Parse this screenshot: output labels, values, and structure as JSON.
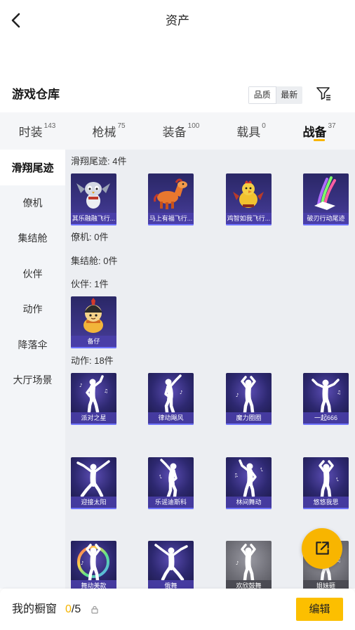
{
  "header": {
    "title": "资产",
    "back_icon": "back-arrow-icon"
  },
  "warehouse": {
    "title": "游戏仓库",
    "sort_options": [
      {
        "label": "品质",
        "selected": true
      },
      {
        "label": "最新",
        "selected": false
      }
    ],
    "filter_icon": "filter-icon"
  },
  "tabs": [
    {
      "label": "时装",
      "count": "143",
      "selected": false
    },
    {
      "label": "枪械",
      "count": "75",
      "selected": false
    },
    {
      "label": "装备",
      "count": "100",
      "selected": false
    },
    {
      "label": "载具",
      "count": "0",
      "selected": false
    },
    {
      "label": "战备",
      "count": "37",
      "selected": true
    }
  ],
  "sidebar": {
    "items": [
      {
        "label": "滑翔尾迹",
        "selected": true
      },
      {
        "label": "僚机",
        "selected": false
      },
      {
        "label": "集结舱",
        "selected": false
      },
      {
        "label": "伙伴",
        "selected": false
      },
      {
        "label": "动作",
        "selected": false
      },
      {
        "label": "降落伞",
        "selected": false
      },
      {
        "label": "大厅场景",
        "selected": false
      }
    ]
  },
  "sections": [
    {
      "title": "滑翔尾迹: 4件",
      "items": [
        {
          "name": "其乐融融飞行...",
          "art": "penguin-glider-icon",
          "card_color": "purple"
        },
        {
          "name": "马上有福飞行...",
          "art": "horse-glider-icon",
          "card_color": "purple"
        },
        {
          "name": "鸡智如我飞行...",
          "art": "chicken-glider-icon",
          "card_color": "purple"
        },
        {
          "name": "破刃行动尾迹",
          "art": "color-trail-icon",
          "card_color": "purple"
        }
      ]
    },
    {
      "title": "僚机: 0件",
      "items": []
    },
    {
      "title": "集结舱: 0件",
      "items": []
    },
    {
      "title": "伙伴: 1件",
      "items": [
        {
          "name": "备仔",
          "art": "helmet-mascot-icon",
          "card_color": "purple"
        }
      ]
    },
    {
      "title": "动作: 18件",
      "items": [
        {
          "name": "派对之星",
          "art": "dancer-silhouette-icon",
          "card_color": "purple"
        },
        {
          "name": "律动飓风",
          "art": "dancer-silhouette-icon",
          "card_color": "purple"
        },
        {
          "name": "魔力圈圈",
          "art": "dancer-silhouette-icon",
          "card_color": "purple"
        },
        {
          "name": "一起666",
          "art": "dancer-silhouette-icon",
          "card_color": "purple"
        },
        {
          "name": "迎接太阳",
          "art": "dancer-silhouette-icon",
          "card_color": "purple"
        },
        {
          "name": "乐谣迪斯科",
          "art": "dancer-silhouette-icon",
          "card_color": "purple"
        },
        {
          "name": "林间舞动",
          "art": "dancer-silhouette-icon",
          "card_color": "purple"
        },
        {
          "name": "悠悠我思",
          "art": "dancer-silhouette-icon",
          "card_color": "purple"
        },
        {
          "name": "舞动美款",
          "art": "rainbow-ring-dancer-icon",
          "card_color": "purple"
        },
        {
          "name": "俄舞",
          "art": "dancer-silhouette-icon",
          "card_color": "purple"
        },
        {
          "name": "欢欣鼓舞",
          "art": "dancer-silhouette-icon",
          "card_color": "gray"
        },
        {
          "name": "姐妹砸",
          "art": "dancer-silhouette-icon",
          "card_color": "gray"
        }
      ]
    }
  ],
  "fab": {
    "icon": "share-icon"
  },
  "showcase": {
    "label": "我的橱窗",
    "used": "0",
    "separator": "/",
    "capacity": "5",
    "lock_icon": "lock-icon",
    "edit_label": "编辑"
  },
  "colors": {
    "accent": "#f8b500",
    "used_count": "#f5b400",
    "card_purple": "#3b3486",
    "card_gray": "#6e6e76",
    "content_bg": "#eceef2"
  }
}
